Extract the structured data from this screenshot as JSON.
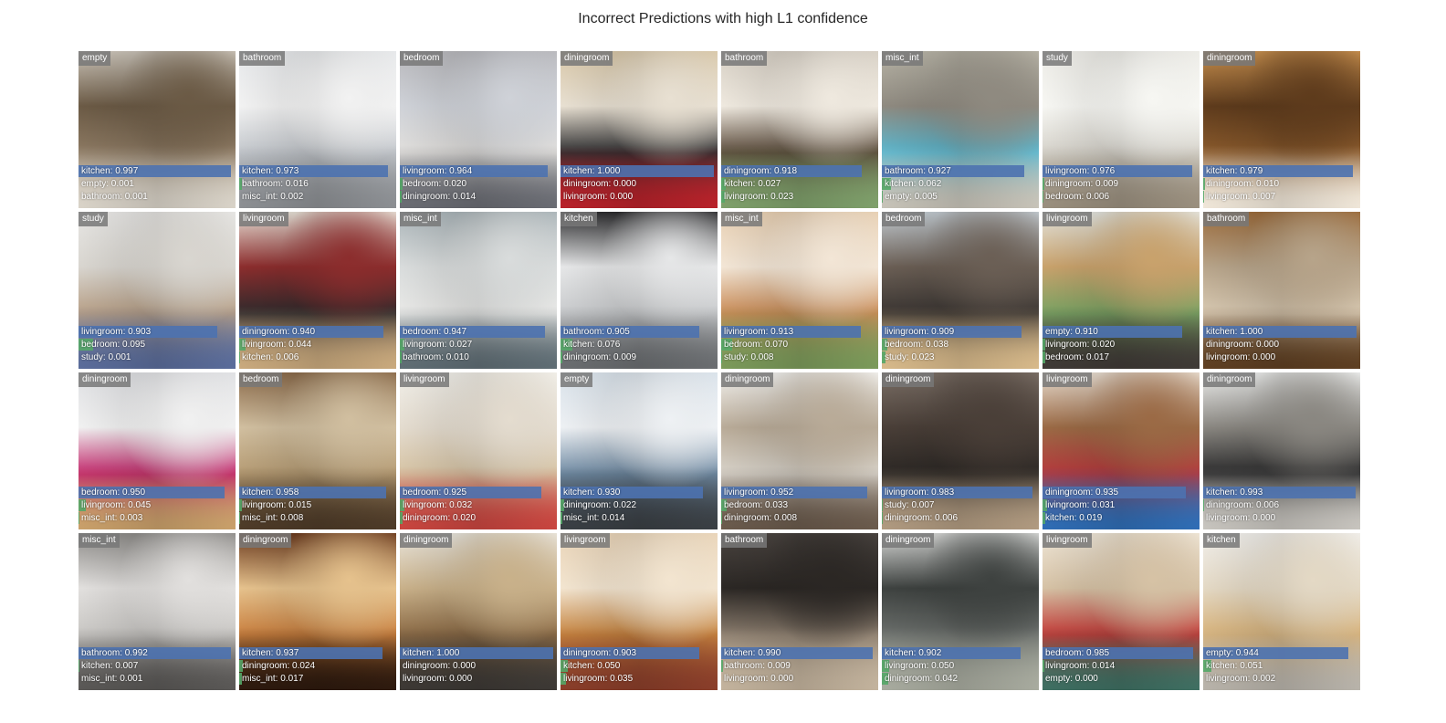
{
  "title": "Incorrect Predictions with high L1 confidence",
  "tiles": [
    {
      "label": "empty",
      "palette": [
        "#c9c2b7",
        "#8d7a63",
        "#d9d3c8",
        "#6b5a45"
      ],
      "preds": [
        [
          "kitchen: 0.997",
          0.997
        ],
        [
          "empty: 0.001",
          0.001
        ],
        [
          "bathroom: 0.001",
          0.001
        ]
      ]
    },
    {
      "label": "bathroom",
      "palette": [
        "#e6e8ea",
        "#c3c7cc",
        "#8c8f93",
        "#f2f2f2"
      ],
      "preds": [
        [
          "kitchen: 0.973",
          0.973
        ],
        [
          "bathroom: 0.016",
          0.016
        ],
        [
          "misc_int: 0.002",
          0.002
        ]
      ]
    },
    {
      "label": "bedroom",
      "palette": [
        "#b8b8bc",
        "#e1dfdc",
        "#6a6c73",
        "#cfd2d8"
      ],
      "preds": [
        [
          "livingroom: 0.964",
          0.964
        ],
        [
          "bedroom: 0.020",
          0.02
        ],
        [
          "diningroom: 0.014",
          0.014
        ]
      ]
    },
    {
      "label": "diningroom",
      "palette": [
        "#d8c7a8",
        "#2e2e30",
        "#b8222a",
        "#e8e0d2"
      ],
      "preds": [
        [
          "kitchen: 1.000",
          1.0
        ],
        [
          "diningroom: 0.000",
          0.0
        ],
        [
          "livingroom: 0.000",
          0.0
        ]
      ]
    },
    {
      "label": "bathroom",
      "palette": [
        "#d6cfc4",
        "#5a4a3a",
        "#7fa06b",
        "#efe9df"
      ],
      "preds": [
        [
          "diningroom: 0.918",
          0.918
        ],
        [
          "kitchen: 0.027",
          0.027
        ],
        [
          "livingroom: 0.023",
          0.023
        ]
      ]
    },
    {
      "label": "misc_int",
      "palette": [
        "#b7b3a6",
        "#5ab7cf",
        "#c7c3b8",
        "#8f8a80"
      ],
      "preds": [
        [
          "bathroom: 0.927",
          0.927
        ],
        [
          "kitchen: 0.062",
          0.062
        ],
        [
          "empty: 0.005",
          0.005
        ]
      ]
    },
    {
      "label": "study",
      "palette": [
        "#ecebe6",
        "#d6d3cb",
        "#9a8f7e",
        "#f7f7f3"
      ],
      "preds": [
        [
          "livingroom: 0.976",
          0.976
        ],
        [
          "diningroom: 0.009",
          0.009
        ],
        [
          "bedroom: 0.006",
          0.006
        ]
      ]
    },
    {
      "label": "diningroom",
      "palette": [
        "#c78f4e",
        "#8a5a2c",
        "#efe6d8",
        "#5e3b1c"
      ],
      "preds": [
        [
          "kitchen: 0.979",
          0.979
        ],
        [
          "diningroom: 0.010",
          0.01
        ],
        [
          "livingroom: 0.007",
          0.007
        ]
      ]
    },
    {
      "label": "study",
      "palette": [
        "#e7e6e4",
        "#b79f86",
        "#5a6c9a",
        "#d9d6d0"
      ],
      "preds": [
        [
          "livingroom: 0.903",
          0.903
        ],
        [
          "bedroom: 0.095",
          0.095
        ],
        [
          "study: 0.001",
          0.001
        ]
      ]
    },
    {
      "label": "livingroom",
      "palette": [
        "#e8e2d8",
        "#2f2a2c",
        "#c9a97d",
        "#8c2d2d"
      ],
      "preds": [
        [
          "diningroom: 0.940",
          0.94
        ],
        [
          "livingroom: 0.044",
          0.044
        ],
        [
          "kitchen: 0.006",
          0.006
        ]
      ]
    },
    {
      "label": "misc_int",
      "palette": [
        "#aab4b8",
        "#e9e9e7",
        "#5f6d74",
        "#d9dcdc"
      ],
      "preds": [
        [
          "bedroom: 0.947",
          0.947
        ],
        [
          "livingroom: 0.027",
          0.027
        ],
        [
          "bathroom: 0.010",
          0.01
        ]
      ]
    },
    {
      "label": "kitchen",
      "palette": [
        "#2b2b2d",
        "#c9cbcd",
        "#6a6d70",
        "#e6e7e8"
      ],
      "preds": [
        [
          "bathroom: 0.905",
          0.905
        ],
        [
          "kitchen: 0.076",
          0.076
        ],
        [
          "diningroom: 0.009",
          0.009
        ]
      ]
    },
    {
      "label": "misc_int",
      "palette": [
        "#e7cfb2",
        "#c98b56",
        "#7b9a5a",
        "#f3e6d6"
      ],
      "preds": [
        [
          "livingroom: 0.913",
          0.913
        ],
        [
          "bedroom: 0.070",
          0.07
        ],
        [
          "study: 0.008",
          0.008
        ]
      ]
    },
    {
      "label": "bedroom",
      "palette": [
        "#c3cbd1",
        "#3a3532",
        "#d7b98a",
        "#6b5f55"
      ],
      "preds": [
        [
          "livingroom: 0.909",
          0.909
        ],
        [
          "bedroom: 0.038",
          0.038
        ],
        [
          "study: 0.023",
          0.023
        ]
      ]
    },
    {
      "label": "livingroom",
      "palette": [
        "#e3e4de",
        "#7aa363",
        "#3f3a36",
        "#c9a26c"
      ],
      "preds": [
        [
          "empty: 0.910",
          0.91
        ],
        [
          "livingroom: 0.020",
          0.02
        ],
        [
          "bedroom: 0.017",
          0.017
        ]
      ]
    },
    {
      "label": "bathroom",
      "palette": [
        "#9b6b3b",
        "#d8c9b2",
        "#5e3f22",
        "#b7a48a"
      ],
      "preds": [
        [
          "kitchen: 1.000",
          1.0
        ],
        [
          "diningroom: 0.000",
          0.0
        ],
        [
          "livingroom: 0.000",
          0.0
        ]
      ]
    },
    {
      "label": "diningroom",
      "palette": [
        "#dfe0e3",
        "#c2276b",
        "#c9a06a",
        "#f1f1f1"
      ],
      "preds": [
        [
          "bedroom: 0.950",
          0.95
        ],
        [
          "livingroom: 0.045",
          0.045
        ],
        [
          "misc_int: 0.003",
          0.003
        ]
      ]
    },
    {
      "label": "bedroom",
      "palette": [
        "#8a6a4a",
        "#b59b73",
        "#4e3b28",
        "#d1bfa0"
      ],
      "preds": [
        [
          "kitchen: 0.958",
          0.958
        ],
        [
          "livingroom: 0.015",
          0.015
        ],
        [
          "misc_int: 0.008",
          0.008
        ]
      ]
    },
    {
      "label": "livingroom",
      "palette": [
        "#f1efe9",
        "#d6c3a3",
        "#c8453f",
        "#e4dccf"
      ],
      "preds": [
        [
          "bedroom: 0.925",
          0.925
        ],
        [
          "livingroom: 0.032",
          0.032
        ],
        [
          "diningroom: 0.020",
          0.02
        ]
      ]
    },
    {
      "label": "empty",
      "palette": [
        "#d9e2ea",
        "#6f8aa3",
        "#3a3f44",
        "#eef1f4"
      ],
      "preds": [
        [
          "kitchen: 0.930",
          0.93
        ],
        [
          "diningroom: 0.022",
          0.022
        ],
        [
          "misc_int: 0.014",
          0.014
        ]
      ]
    },
    {
      "label": "diningroom",
      "palette": [
        "#f2f1ee",
        "#d9d4cb",
        "#6a5a4c",
        "#b9ab98"
      ],
      "preds": [
        [
          "livingroom: 0.952",
          0.952
        ],
        [
          "bedroom: 0.033",
          0.033
        ],
        [
          "diningroom: 0.008",
          0.008
        ]
      ]
    },
    {
      "label": "diningroom",
      "palette": [
        "#7b6f66",
        "#2b2724",
        "#b09a80",
        "#4a3f38"
      ],
      "preds": [
        [
          "livingroom: 0.983",
          0.983
        ],
        [
          "study: 0.007",
          0.007
        ],
        [
          "diningroom: 0.006",
          0.006
        ]
      ]
    },
    {
      "label": "livingroom",
      "palette": [
        "#e8ddd0",
        "#b6383c",
        "#2f6db5",
        "#9b6a45"
      ],
      "preds": [
        [
          "diningroom: 0.935",
          0.935
        ],
        [
          "livingroom: 0.031",
          0.031
        ],
        [
          "kitchen: 0.019",
          0.019
        ]
      ]
    },
    {
      "label": "diningroom",
      "palette": [
        "#edeeed",
        "#2b2b2c",
        "#c7c4be",
        "#8a8781"
      ],
      "preds": [
        [
          "kitchen: 0.993",
          0.993
        ],
        [
          "diningroom: 0.006",
          0.006
        ],
        [
          "livingroom: 0.000",
          0.0
        ]
      ]
    },
    {
      "label": "misc_int",
      "palette": [
        "#8d8b88",
        "#c9c7c4",
        "#5a5856",
        "#e2e0de"
      ],
      "preds": [
        [
          "bathroom: 0.992",
          0.992
        ],
        [
          "kitchen: 0.007",
          0.007
        ],
        [
          "misc_int: 0.001",
          0.001
        ]
      ]
    },
    {
      "label": "diningroom",
      "palette": [
        "#6b3a1e",
        "#c97f3e",
        "#2e1a0e",
        "#e6c28d"
      ],
      "preds": [
        [
          "kitchen: 0.937",
          0.937
        ],
        [
          "diningroom: 0.024",
          0.024
        ],
        [
          "misc_int: 0.017",
          0.017
        ]
      ]
    },
    {
      "label": "diningroom",
      "palette": [
        "#e9e5dc",
        "#8b6a45",
        "#3d3935",
        "#c9b18a"
      ],
      "preds": [
        [
          "kitchen: 1.000",
          1.0
        ],
        [
          "diningroom: 0.000",
          0.0
        ],
        [
          "livingroom: 0.000",
          0.0
        ]
      ]
    },
    {
      "label": "livingroom",
      "palette": [
        "#e9d4b8",
        "#c6843f",
        "#8a3e2a",
        "#f3e5d0"
      ],
      "preds": [
        [
          "diningroom: 0.903",
          0.903
        ],
        [
          "kitchen: 0.050",
          0.05
        ],
        [
          "livingroom: 0.035",
          0.035
        ]
      ]
    },
    {
      "label": "bathroom",
      "palette": [
        "#4a4440",
        "#8b7d6e",
        "#c3b39d",
        "#2b2724"
      ],
      "preds": [
        [
          "kitchen: 0.990",
          0.99
        ],
        [
          "bathroom: 0.009",
          0.009
        ],
        [
          "livingroom: 0.000",
          0.0
        ]
      ]
    },
    {
      "label": "diningroom",
      "palette": [
        "#d7d8d6",
        "#6b6f6c",
        "#a8ab9f",
        "#3e4240"
      ],
      "preds": [
        [
          "kitchen: 0.902",
          0.902
        ],
        [
          "livingroom: 0.050",
          0.05
        ],
        [
          "diningroom: 0.042",
          0.042
        ]
      ]
    },
    {
      "label": "livingroom",
      "palette": [
        "#efe6d7",
        "#c33a37",
        "#3f6f62",
        "#d6c2a5"
      ],
      "preds": [
        [
          "bedroom: 0.985",
          0.985
        ],
        [
          "livingroom: 0.014",
          0.014
        ],
        [
          "empty: 0.000",
          0.0
        ]
      ]
    },
    {
      "label": "kitchen",
      "palette": [
        "#f1efeb",
        "#d7b27a",
        "#b8b3aa",
        "#e4d9c5"
      ],
      "preds": [
        [
          "empty: 0.944",
          0.944
        ],
        [
          "kitchen: 0.051",
          0.051
        ],
        [
          "livingroom: 0.002",
          0.002
        ]
      ]
    }
  ]
}
